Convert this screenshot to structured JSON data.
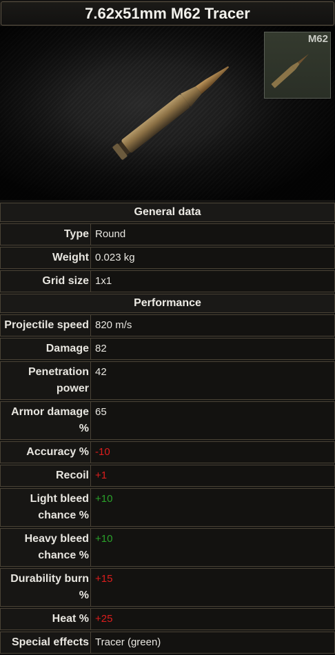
{
  "title": "7.62x51mm M62 Tracer",
  "thumb_label": "M62",
  "sections": {
    "general": "General data",
    "performance": "Performance"
  },
  "general_rows": [
    {
      "label": "Type",
      "value": "Round"
    },
    {
      "label": "Weight",
      "value": "0.023 kg"
    },
    {
      "label": "Grid size",
      "value": "1x1"
    }
  ],
  "performance_rows": [
    {
      "label": "Projectile speed",
      "value": "820 m/s"
    },
    {
      "label": "Damage",
      "value": "82"
    },
    {
      "label": "Penetration power",
      "value": "42"
    },
    {
      "label": "Armor damage %",
      "value": "65"
    },
    {
      "label": "Accuracy %",
      "value": "-10"
    },
    {
      "label": "Recoil",
      "value": "+1"
    },
    {
      "label": "Light bleed chance %",
      "value": "+10"
    },
    {
      "label": "Heavy bleed chance %",
      "value": "+10"
    },
    {
      "label": "Durability burn %",
      "value": "+15"
    },
    {
      "label": "Heat %",
      "value": "+25"
    },
    {
      "label": "Special effects",
      "value": "Tracer (green)"
    }
  ],
  "colors": {
    "negative": "#dd1d1d",
    "positive": "#2aa12a"
  }
}
